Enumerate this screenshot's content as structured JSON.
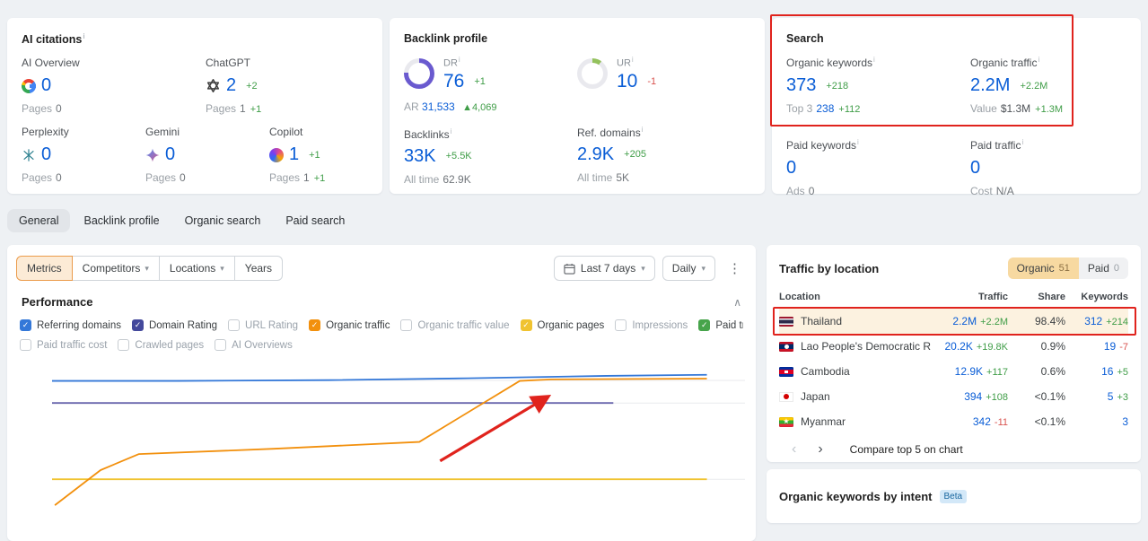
{
  "ui": {
    "info": "i",
    "caret": "▾",
    "kebab": "⋮",
    "collapse": "∧",
    "prev": "‹",
    "next": "›",
    "check": "✓",
    "up_triangle": "▲"
  },
  "ai_citations": {
    "title": "AI citations",
    "items": [
      {
        "name": "AI Overview",
        "icon": "google",
        "value": "0",
        "value_change": "",
        "pages_label": "Pages",
        "pages_value": "0",
        "pages_change": ""
      },
      {
        "name": "ChatGPT",
        "icon": "chatgpt",
        "value": "2",
        "value_change": "+2",
        "pages_label": "Pages",
        "pages_value": "1",
        "pages_change": "+1"
      },
      {
        "name": "Perplexity",
        "icon": "perplexity",
        "value": "0",
        "value_change": "",
        "pages_label": "Pages",
        "pages_value": "0",
        "pages_change": ""
      },
      {
        "name": "Gemini",
        "icon": "gemini",
        "value": "0",
        "value_change": "",
        "pages_label": "Pages",
        "pages_value": "0",
        "pages_change": ""
      },
      {
        "name": "Copilot",
        "icon": "copilot",
        "value": "1",
        "value_change": "+1",
        "pages_label": "Pages",
        "pages_value": "1",
        "pages_change": "+1"
      }
    ]
  },
  "backlink_profile": {
    "title": "Backlink profile",
    "dr": {
      "label": "DR",
      "value": "76",
      "change": "+1",
      "ar_label": "AR",
      "ar_value": "31,533",
      "ar_change": "4,069"
    },
    "ur": {
      "label": "UR",
      "value": "10",
      "change": "-1"
    },
    "backlinks": {
      "label": "Backlinks",
      "value": "33K",
      "change": "+5.5K",
      "alltime_label": "All time",
      "alltime_value": "62.9K"
    },
    "ref_domains": {
      "label": "Ref. domains",
      "value": "2.9K",
      "change": "+205",
      "alltime_label": "All time",
      "alltime_value": "5K"
    }
  },
  "search": {
    "title": "Search",
    "organic_keywords": {
      "label": "Organic keywords",
      "value": "373",
      "change": "+218",
      "sub_label": "Top 3",
      "sub_value": "238",
      "sub_change": "+112"
    },
    "organic_traffic": {
      "label": "Organic traffic",
      "value": "2.2M",
      "change": "+2.2M",
      "sub_label": "Value",
      "sub_value": "$1.3M",
      "sub_change": "+1.3M"
    },
    "paid_keywords": {
      "label": "Paid keywords",
      "value": "0",
      "change": "",
      "sub_label": "Ads",
      "sub_value": "0",
      "sub_change": ""
    },
    "paid_traffic": {
      "label": "Paid traffic",
      "value": "0",
      "change": "",
      "sub_label": "Cost",
      "sub_value": "N/A",
      "sub_change": ""
    }
  },
  "tabs": {
    "items": [
      {
        "label": "General",
        "active": true
      },
      {
        "label": "Backlink profile"
      },
      {
        "label": "Organic search"
      },
      {
        "label": "Paid search"
      }
    ]
  },
  "toolbar": {
    "metrics": "Metrics",
    "competitors": "Competitors",
    "locations": "Locations",
    "years": "Years",
    "date_range": "Last 7 days",
    "granularity": "Daily"
  },
  "performance": {
    "title": "Performance",
    "legend": [
      {
        "label": "Referring domains",
        "checked": true,
        "color": "#3478d8",
        "row": 1
      },
      {
        "label": "Domain Rating",
        "checked": true,
        "color": "#44499c",
        "row": 1
      },
      {
        "label": "URL Rating",
        "checked": false,
        "row": 1
      },
      {
        "label": "Organic traffic",
        "checked": true,
        "color": "#f2900d",
        "row": 1
      },
      {
        "label": "Organic traffic value",
        "checked": false,
        "row": 1
      },
      {
        "label": "Organic pages",
        "checked": true,
        "color": "#f0c330",
        "row": 1
      },
      {
        "label": "Impressions",
        "checked": false,
        "row": 1
      },
      {
        "label": "Paid traffic",
        "checked": true,
        "color": "#47a44b",
        "row": 1
      },
      {
        "label": "Paid traffic cost",
        "checked": false,
        "row": 2
      },
      {
        "label": "Crawled pages",
        "checked": false,
        "row": 2
      },
      {
        "label": "AI Overviews",
        "checked": false,
        "row": 2
      }
    ]
  },
  "chart_data": {
    "type": "line",
    "title": "Performance",
    "x_range_label": "Last 7 days",
    "y_axis_labels_visible": false,
    "legend_position": "top",
    "grid": true,
    "gridlines_y": [
      0.112,
      0.26,
      0.76
    ],
    "series": [
      {
        "name": "Organic pages",
        "color": "#f0c330",
        "points": [
          [
            0,
            0.76
          ],
          [
            0.945,
            0.76
          ]
        ]
      },
      {
        "name": "Domain Rating",
        "color": "#6a67ad",
        "points": [
          [
            0,
            0.26
          ],
          [
            0.81,
            0.26
          ]
        ]
      },
      {
        "name": "Referring domains",
        "color": "#3478d8",
        "points": [
          [
            0,
            0.115
          ],
          [
            0.18,
            0.115
          ],
          [
            0.4,
            0.11
          ],
          [
            0.6,
            0.098
          ],
          [
            0.8,
            0.082
          ],
          [
            0.945,
            0.075
          ]
        ]
      },
      {
        "name": "Organic traffic",
        "color": "#f2900d",
        "points": [
          [
            0.004,
            0.93
          ],
          [
            0.07,
            0.7
          ],
          [
            0.125,
            0.595
          ],
          [
            0.32,
            0.56
          ],
          [
            0.53,
            0.515
          ],
          [
            0.675,
            0.115
          ],
          [
            0.72,
            0.105
          ],
          [
            0.945,
            0.1
          ]
        ]
      }
    ],
    "annotation_arrow": {
      "from": [
        0.56,
        0.64
      ],
      "to": [
        0.715,
        0.22
      ],
      "color": "#e0231d"
    }
  },
  "traffic_by_location": {
    "title": "Traffic by location",
    "toggle": {
      "organic_label": "Organic",
      "organic_count": "51",
      "paid_label": "Paid",
      "paid_count": "0"
    },
    "headers": [
      "Location",
      "Traffic",
      "Share",
      "Keywords"
    ],
    "rows": [
      {
        "location": "Thailand",
        "flag": "th",
        "traffic": "2.2M",
        "traffic_change": "+2.2M",
        "share": "98.4%",
        "keywords": "312",
        "keywords_change": "+214",
        "highlighted": true
      },
      {
        "location": "Lao People's Democratic Reput",
        "flag": "la",
        "traffic": "20.2K",
        "traffic_change": "+19.8K",
        "share": "0.9%",
        "keywords": "19",
        "keywords_change": "-7"
      },
      {
        "location": "Cambodia",
        "flag": "kh",
        "traffic": "12.9K",
        "traffic_change": "+117",
        "share": "0.6%",
        "keywords": "16",
        "keywords_change": "+5"
      },
      {
        "location": "Japan",
        "flag": "jp",
        "traffic": "394",
        "traffic_change": "+108",
        "share": "<0.1%",
        "keywords": "5",
        "keywords_change": "+3"
      },
      {
        "location": "Myanmar",
        "flag": "mm",
        "traffic": "342",
        "traffic_change": "-11",
        "share": "<0.1%",
        "keywords": "3",
        "keywords_change": ""
      }
    ],
    "footer": {
      "compare_label": "Compare top 5 on chart"
    }
  },
  "organic_keywords_by_intent": {
    "title": "Organic keywords by intent",
    "badge": "Beta"
  }
}
